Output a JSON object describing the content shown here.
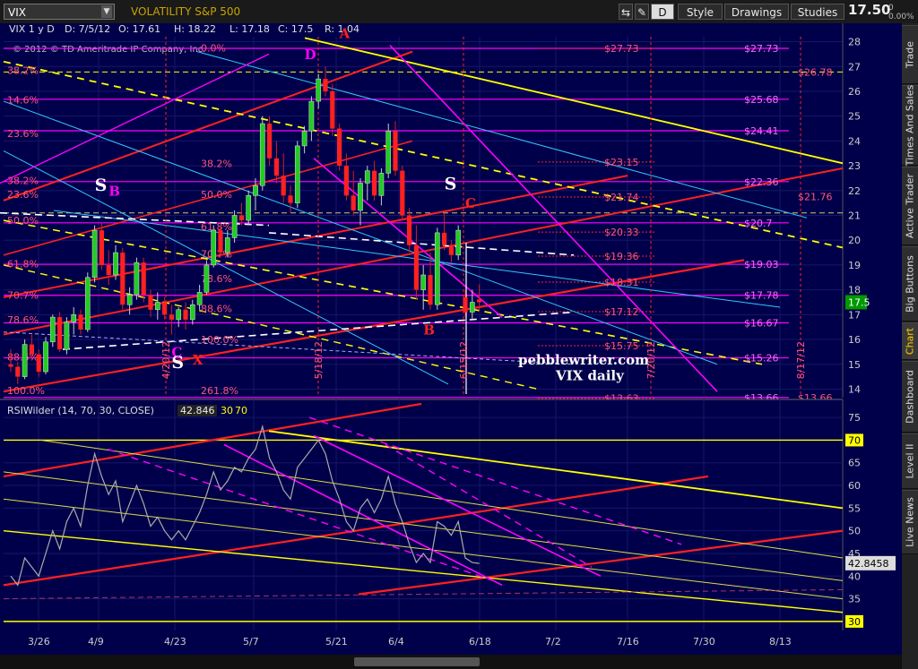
{
  "toolbar": {
    "symbol": "VIX",
    "description": "VOLATILITY S&P 500",
    "period_button": "D",
    "style_label": "Style",
    "drawings_label": "Drawings",
    "studies_label": "Studies",
    "last_price": "17.50",
    "change_pct": "0",
    "change_pct2": "0.00%"
  },
  "sidebar_tabs": [
    "Trade",
    "Times And Sales",
    "Active Trader",
    "Big Buttons",
    "Chart",
    "Dashboard",
    "Level II",
    "Live News"
  ],
  "sidebar_active": "Chart",
  "colors": {
    "bg": "#00004a",
    "grid": "#16166a",
    "red": "#ff2020",
    "magenta": "#ff00ff",
    "yellow": "#ffff00",
    "cyan": "#30c8ff",
    "white": "#ffffff",
    "up": "#22cc22",
    "down": "#ff2020",
    "fib": "#ff5577"
  },
  "chart_data": [
    {
      "type": "candlestick",
      "header": "VIX 1 y D",
      "ohlc_readout": {
        "date": "D: 7/5/12",
        "open": "O: 17.61",
        "high": "H: 18.22",
        "low": "L: 17.18",
        "close": "C: 17.5",
        "range": "R: 1.04"
      },
      "copyright": "© 2012 © TD Ameritrade IP Company, Inc.",
      "ylim": [
        13.8,
        28.2
      ],
      "y_ticks": [
        14,
        15,
        16,
        17,
        18,
        19,
        20,
        21,
        22,
        23,
        24,
        25,
        26,
        27,
        28
      ],
      "x_ticks": [
        "3/26",
        "4/9",
        "4/23",
        "5/7",
        "5/21",
        "6/4",
        "6/18",
        "7/2",
        "7/16",
        "7/30",
        "8/13"
      ],
      "current_price_tag": "17.5",
      "date_labels": [
        "4/20/12",
        "5/18/12",
        "6/15/12",
        "7/20/12",
        "8/17/12"
      ],
      "left_fibs": [
        {
          "label": "38.2%",
          "value": 26.85
        },
        {
          "label": "14.6%",
          "value": 25.65
        },
        {
          "label": "23.6%",
          "value": 24.3
        },
        {
          "label": "38.2%",
          "value": 22.4
        },
        {
          "label": "23.6%",
          "value": 21.85
        },
        {
          "label": "50.0%",
          "value": 20.8
        },
        {
          "label": "61.8%",
          "value": 19.05
        },
        {
          "label": "70.7%",
          "value": 17.78
        },
        {
          "label": "78.6%",
          "value": 16.8
        },
        {
          "label": "88.6%",
          "value": 15.3
        },
        {
          "label": "100.0%",
          "value": 13.95
        }
      ],
      "mid_fibs": [
        {
          "label": "0.0%",
          "value": 27.75
        },
        {
          "label": "38.2%",
          "value": 23.1
        },
        {
          "label": "50.0%",
          "value": 21.85
        },
        {
          "label": "61.8%",
          "value": 20.55
        },
        {
          "label": "70.7%",
          "value": 19.45
        },
        {
          "label": "78.6%",
          "value": 18.45
        },
        {
          "label": "88.6%",
          "value": 17.25
        },
        {
          "label": "100.0%",
          "value": 16.0
        },
        {
          "label": "261.8%",
          "value": 13.95
        }
      ],
      "red_level_labels": [
        {
          "label": "$27.73",
          "value": 27.73
        },
        {
          "label": "$23.15",
          "value": 23.15
        },
        {
          "label": "$21.74",
          "value": 21.74
        },
        {
          "label": "$20.33",
          "value": 20.33
        },
        {
          "label": "$19.36",
          "value": 19.36
        },
        {
          "label": "$18.31",
          "value": 18.31
        },
        {
          "label": "$17.12",
          "value": 17.12
        },
        {
          "label": "$15.75",
          "value": 15.75
        },
        {
          "label": "$13.63",
          "value": 13.63
        }
      ],
      "magenta_level_labels": [
        {
          "label": "$27.73",
          "value": 27.73
        },
        {
          "label": "$25.68",
          "value": 25.68
        },
        {
          "label": "$24.41",
          "value": 24.41
        },
        {
          "label": "$22.36",
          "value": 22.36
        },
        {
          "label": "$20.7",
          "value": 20.7
        },
        {
          "label": "$19.03",
          "value": 19.03
        },
        {
          "label": "$17.78",
          "value": 17.78
        },
        {
          "label": "$16.67",
          "value": 16.67
        },
        {
          "label": "$15.26",
          "value": 15.26
        },
        {
          "label": "$13.66",
          "value": 13.66
        }
      ],
      "right_red_labels": [
        {
          "label": "$26.78",
          "value": 26.78
        },
        {
          "label": "$21.76",
          "value": 21.76
        },
        {
          "label": "$13.66",
          "value": 13.66
        }
      ],
      "pattern_labels": [
        {
          "text": "A",
          "color": "red",
          "bar": 47,
          "value": 28.15
        },
        {
          "text": "D",
          "color": "magenta",
          "bar": 42,
          "value": 27.3
        },
        {
          "text": "S",
          "color": "white",
          "bar": 12,
          "value": 22.0
        },
        {
          "text": "B",
          "color": "magenta",
          "bar": 14,
          "value": 21.8
        },
        {
          "text": "S",
          "color": "white",
          "bar": 62,
          "value": 22.05
        },
        {
          "text": "C",
          "color": "red",
          "bar": 65,
          "value": 21.3
        },
        {
          "text": "C",
          "color": "magenta",
          "bar": 23,
          "value": 15.3
        },
        {
          "text": "S",
          "color": "white",
          "bar": 23,
          "value": 14.85
        },
        {
          "text": "X",
          "color": "red",
          "bar": 26,
          "value": 15.0
        },
        {
          "text": "B",
          "color": "red",
          "bar": 59,
          "value": 16.2
        }
      ],
      "watermark": [
        "pebblewriter.com",
        "VIX daily"
      ],
      "candles": [
        [
          15.0,
          15.6,
          14.7,
          14.9
        ],
        [
          14.9,
          15.1,
          14.2,
          14.5
        ],
        [
          14.5,
          16.0,
          14.4,
          15.8
        ],
        [
          15.8,
          16.2,
          15.2,
          15.4
        ],
        [
          15.4,
          15.6,
          14.5,
          14.7
        ],
        [
          14.7,
          16.1,
          14.6,
          15.9
        ],
        [
          15.9,
          17.0,
          15.7,
          16.9
        ],
        [
          16.9,
          17.1,
          15.5,
          15.6
        ],
        [
          15.6,
          16.9,
          15.4,
          16.7
        ],
        [
          16.7,
          17.3,
          16.2,
          17.0
        ],
        [
          17.0,
          17.2,
          16.2,
          16.4
        ],
        [
          16.4,
          18.7,
          16.3,
          18.5
        ],
        [
          18.5,
          20.6,
          18.3,
          20.4
        ],
        [
          20.4,
          20.7,
          18.8,
          19.0
        ],
        [
          19.0,
          19.6,
          18.2,
          18.6
        ],
        [
          18.6,
          19.8,
          18.4,
          19.5
        ],
        [
          19.5,
          19.7,
          17.2,
          17.4
        ],
        [
          17.4,
          18.1,
          17.0,
          17.8
        ],
        [
          17.8,
          19.3,
          17.6,
          19.1
        ],
        [
          19.1,
          19.3,
          17.5,
          17.8
        ],
        [
          17.8,
          18.0,
          16.9,
          17.2
        ],
        [
          17.2,
          17.9,
          16.8,
          17.5
        ],
        [
          17.5,
          17.7,
          16.8,
          17.0
        ],
        [
          17.0,
          17.4,
          16.2,
          16.8
        ],
        [
          16.8,
          17.3,
          16.5,
          17.2
        ],
        [
          17.2,
          17.5,
          16.4,
          16.8
        ],
        [
          16.8,
          17.6,
          16.6,
          17.4
        ],
        [
          17.4,
          18.2,
          17.2,
          17.9
        ],
        [
          17.9,
          19.2,
          17.8,
          19.0
        ],
        [
          19.0,
          20.6,
          18.9,
          20.4
        ],
        [
          20.4,
          20.6,
          19.3,
          19.5
        ],
        [
          19.5,
          20.4,
          19.3,
          20.1
        ],
        [
          20.1,
          21.2,
          19.9,
          21.0
        ],
        [
          21.0,
          21.5,
          20.6,
          20.8
        ],
        [
          20.8,
          22.0,
          20.6,
          21.8
        ],
        [
          21.8,
          22.5,
          21.2,
          22.2
        ],
        [
          22.2,
          25.0,
          22.0,
          24.7
        ],
        [
          24.7,
          25.0,
          23.0,
          23.3
        ],
        [
          23.3,
          24.0,
          22.3,
          22.6
        ],
        [
          22.6,
          23.5,
          21.5,
          21.8
        ],
        [
          21.8,
          22.2,
          21.1,
          21.5
        ],
        [
          21.5,
          24.0,
          21.3,
          23.8
        ],
        [
          23.8,
          24.6,
          23.5,
          24.4
        ],
        [
          24.4,
          25.8,
          24.0,
          25.6
        ],
        [
          25.6,
          26.7,
          25.3,
          26.5
        ],
        [
          26.5,
          27.0,
          25.8,
          26.0
        ],
        [
          26.0,
          26.3,
          24.2,
          24.5
        ],
        [
          24.5,
          24.7,
          22.8,
          23.0
        ],
        [
          23.0,
          23.5,
          21.6,
          21.8
        ],
        [
          21.8,
          22.8,
          21.0,
          21.2
        ],
        [
          21.2,
          22.5,
          20.6,
          22.3
        ],
        [
          22.3,
          23.0,
          21.6,
          22.8
        ],
        [
          22.8,
          23.2,
          21.6,
          21.8
        ],
        [
          21.8,
          22.9,
          21.4,
          22.7
        ],
        [
          22.7,
          24.7,
          22.5,
          24.4
        ],
        [
          24.4,
          24.8,
          22.6,
          22.8
        ],
        [
          22.8,
          23.0,
          20.8,
          21.0
        ],
        [
          21.0,
          21.3,
          19.5,
          19.8
        ],
        [
          19.8,
          20.6,
          17.6,
          18.0
        ],
        [
          18.0,
          19.0,
          17.2,
          18.6
        ],
        [
          18.6,
          19.5,
          17.2,
          17.4
        ],
        [
          17.4,
          20.5,
          17.2,
          20.3
        ],
        [
          20.3,
          21.1,
          19.6,
          19.8
        ],
        [
          19.8,
          20.0,
          19.1,
          19.4
        ],
        [
          19.4,
          20.6,
          19.2,
          20.4
        ],
        [
          17.7,
          18.0,
          16.9,
          17.1
        ],
        [
          17.1,
          18.0,
          16.8,
          17.5
        ],
        [
          17.61,
          18.22,
          17.18,
          17.5
        ]
      ]
    },
    {
      "type": "line",
      "name": "RSIWilder",
      "header": "RSIWilder (14, 70, 30, CLOSE)",
      "value_label": "42.846",
      "over_label": "30",
      "under_label": "70",
      "ylim": [
        28,
        77
      ],
      "y_ticks": [
        30,
        35,
        40,
        45,
        50,
        55,
        60,
        65,
        70,
        75
      ],
      "overbought": 70,
      "oversold": 30,
      "current_value_tag": "42.8458",
      "values": [
        40,
        38,
        44,
        42,
        40,
        45,
        50,
        46,
        52,
        55,
        51,
        60,
        67,
        62,
        58,
        61,
        52,
        56,
        60,
        56,
        51,
        53,
        50,
        48,
        50,
        48,
        51,
        54,
        58,
        63,
        59,
        61,
        64,
        63,
        66,
        68,
        73,
        66,
        63,
        59,
        57,
        64,
        66,
        68,
        70,
        67,
        61,
        57,
        52,
        50,
        55,
        57,
        54,
        57,
        62,
        56,
        52,
        47,
        43,
        45,
        43,
        52,
        51,
        49,
        52,
        44,
        43,
        42.8
      ]
    }
  ]
}
